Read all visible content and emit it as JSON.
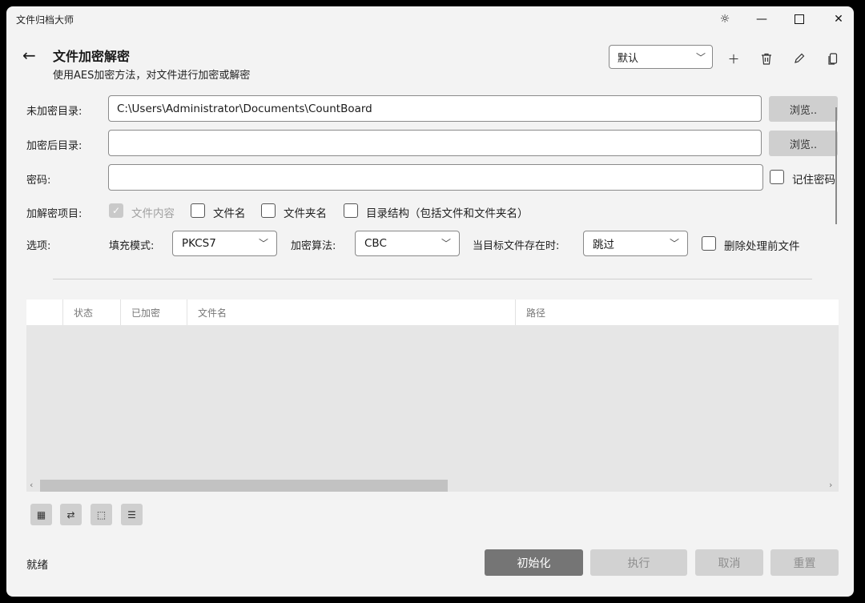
{
  "app": {
    "title": "文件归档大师"
  },
  "header": {
    "title": "文件加密解密",
    "subtitle": "使用AES加密方法，对文件进行加密或解密"
  },
  "profile": {
    "selected": "默认"
  },
  "form": {
    "source_label": "未加密目录:",
    "source_value": "C:\\Users\\Administrator\\Documents\\CountBoard",
    "target_label": "加密后目录:",
    "target_value": "",
    "password_label": "密码:",
    "password_value": "",
    "browse_label": "浏览..",
    "remember_password": "记住密码",
    "items_label": "加解密项目:",
    "items": [
      "文件内容",
      "文件名",
      "文件夹名",
      "目录结构（包括文件和文件夹名）"
    ],
    "options_label": "选项:",
    "padding_label": "填充模式:",
    "padding_value": "PKCS7",
    "algo_label": "加密算法:",
    "algo_value": "CBC",
    "exists_label": "当目标文件存在时:",
    "exists_value": "跳过",
    "delete_label": "删除处理前文件"
  },
  "table": {
    "columns": [
      "状态",
      "已加密",
      "文件名",
      "路径"
    ]
  },
  "status": "就绪",
  "actions": {
    "init": "初始化",
    "execute": "执行",
    "cancel": "取消",
    "reset": "重置"
  },
  "icons": {
    "theme": "sun-icon",
    "add": "plus-icon",
    "delete": "trash-icon",
    "edit": "pencil-icon",
    "copy": "copy-icon"
  }
}
